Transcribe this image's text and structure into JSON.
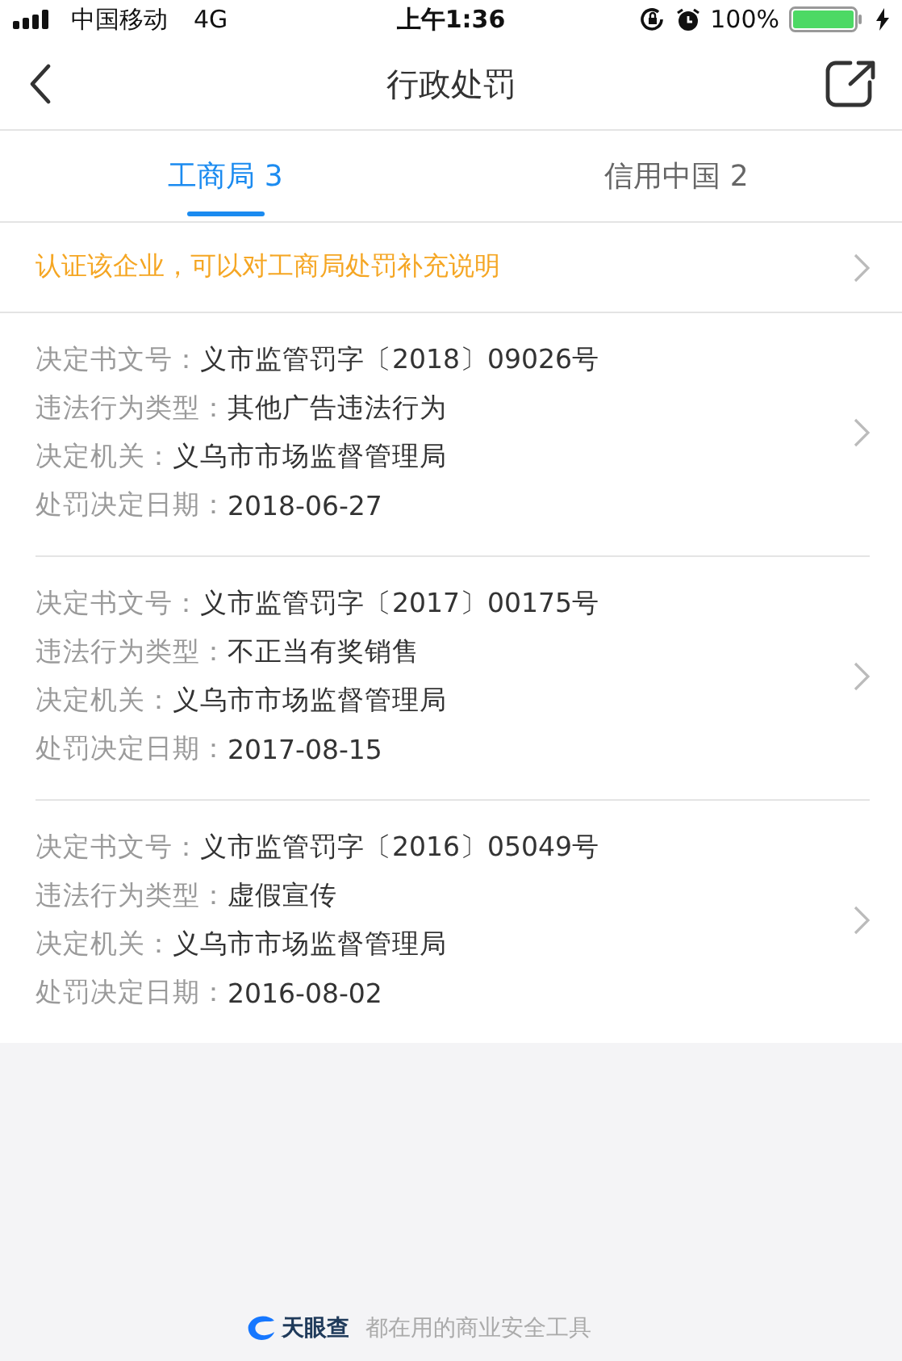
{
  "status_bar": {
    "carrier": "中国移动",
    "network": "4G",
    "time": "上午1:36",
    "battery": "100%"
  },
  "nav": {
    "title": "行政处罚"
  },
  "tabs": [
    {
      "label": "工商局 3",
      "selected": true
    },
    {
      "label": "信用中国 2",
      "selected": false
    }
  ],
  "notice": "认证该企业，可以对工商局处罚补充说明",
  "records": [
    {
      "fields": [
        {
          "label": "决定书文号：",
          "value": "义市监管罚字〔2018〕09026号"
        },
        {
          "label": "违法行为类型：",
          "value": "其他广告违法行为"
        },
        {
          "label": "决定机关：",
          "value": "义乌市市场监督管理局"
        },
        {
          "label": "处罚决定日期：",
          "value": "2018-06-27"
        }
      ]
    },
    {
      "fields": [
        {
          "label": "决定书文号：",
          "value": "义市监管罚字〔2017〕00175号"
        },
        {
          "label": "违法行为类型：",
          "value": "不正当有奖销售"
        },
        {
          "label": "决定机关：",
          "value": "义乌市市场监督管理局"
        },
        {
          "label": "处罚决定日期：",
          "value": "2017-08-15"
        }
      ]
    },
    {
      "fields": [
        {
          "label": "决定书文号：",
          "value": "义市监管罚字〔2016〕05049号"
        },
        {
          "label": "违法行为类型：",
          "value": "虚假宣传"
        },
        {
          "label": "决定机关：",
          "value": "义乌市市场监督管理局"
        },
        {
          "label": "处罚决定日期：",
          "value": "2016-08-02"
        }
      ]
    }
  ],
  "footer": {
    "brand": "天眼查",
    "slogan": "都在用的商业安全工具"
  }
}
